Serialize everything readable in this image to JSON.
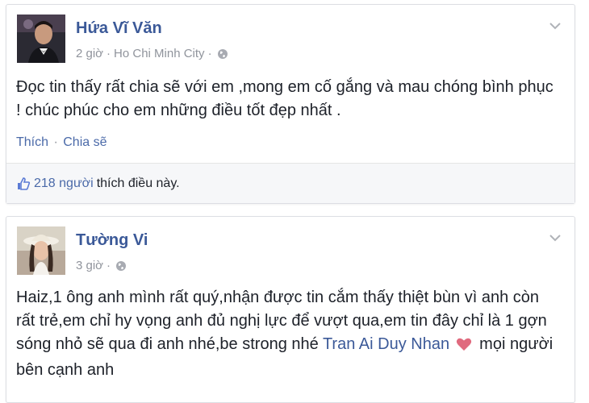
{
  "posts": [
    {
      "author": "Hứa Vĩ Văn",
      "time": "2 giờ",
      "location": "Ho Chi Minh City",
      "separator": "·",
      "text": "Đọc tin thấy rất chia sẽ với em ,mong em cố gắng và mau chóng bình phục ! chúc phúc cho em những điều tốt đẹp nhất .",
      "actions": {
        "like": "Thích",
        "share": "Chia sẽ"
      },
      "likes": {
        "count": "218 người",
        "suffix": "thích điều này."
      }
    },
    {
      "author": "Tường Vi",
      "time": "3 giờ",
      "separator": "·",
      "text_before": "Haiz,1 ông anh mình rất quý,nhận được tin cắm thấy thiệt bùn vì anh còn rất trẻ,em chỉ hy vọng anh đủ nghị lực để vượt qua,em tin đây chỉ là 1 gợn sóng nhỏ sẽ qua đi anh nhé,be strong nhé ",
      "mention": "Tran Ai Duy Nhan",
      "text_after": " mọi người bên cạnh anh"
    }
  ],
  "colors": {
    "link": "#3b5998",
    "meta": "#90949c",
    "heart": "#e06a7e"
  },
  "icons": [
    "globe-icon",
    "chevron-down-icon",
    "like-thumb-icon",
    "heart-emoji-icon"
  ]
}
